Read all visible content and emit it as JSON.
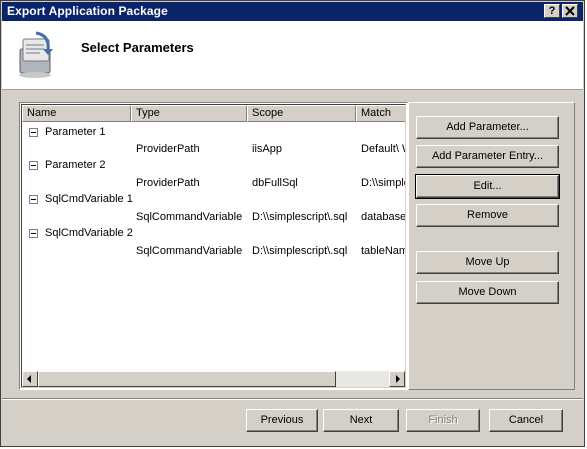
{
  "window": {
    "title": "Export Application Package",
    "help_glyph": "?",
    "close_glyph": "X"
  },
  "header": {
    "heading": "Select Parameters"
  },
  "list": {
    "columns": [
      "Name",
      "Type",
      "Scope",
      "Match"
    ],
    "groups": [
      {
        "name": "Parameter 1",
        "entry": {
          "type": "ProviderPath",
          "scope": "iisApp",
          "match": "Default\\ W"
        }
      },
      {
        "name": "Parameter 2",
        "entry": {
          "type": "ProviderPath",
          "scope": "dbFullSql",
          "match": "D:\\\\simple"
        }
      },
      {
        "name": "SqlCmdVariable 1",
        "entry": {
          "type": "SqlCommandVariable",
          "scope": "D:\\\\simplescript\\.sql",
          "match": "database"
        }
      },
      {
        "name": "SqlCmdVariable 2",
        "entry": {
          "type": "SqlCommandVariable",
          "scope": "D:\\\\simplescript\\.sql",
          "match": "tableNam"
        }
      }
    ]
  },
  "side_buttons": {
    "add_parameter": "Add Parameter...",
    "add_parameter_entry": "Add Parameter Entry...",
    "edit": "Edit...",
    "remove": "Remove",
    "move_up": "Move Up",
    "move_down": "Move Down"
  },
  "footer": {
    "previous": "Previous",
    "next": "Next",
    "finish": "Finish",
    "cancel": "Cancel"
  },
  "colors": {
    "titlebar": "#0a246a",
    "face": "#d4d0c8",
    "disabled_text": "#808080"
  }
}
